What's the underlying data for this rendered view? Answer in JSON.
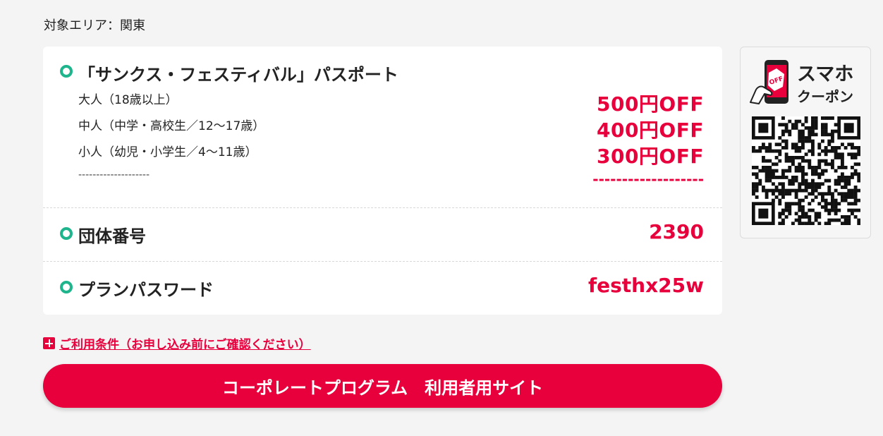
{
  "area": {
    "label": "対象エリア：関東"
  },
  "passport": {
    "title": "「サンクス・フェスティバル」パスポート",
    "tiers": [
      {
        "label": "大人（18歳以上）",
        "discount": "500円OFF"
      },
      {
        "label": "中人（中学・高校生／12～17歳）",
        "discount": "400円OFF"
      },
      {
        "label": "小人（幼児・小学生／4～11歳）",
        "discount": "300円OFF"
      }
    ],
    "separator_left": "--------------------",
    "separator_right": "-------------------"
  },
  "group": {
    "label": "団体番号",
    "value": "2390"
  },
  "plan": {
    "label": "プランパスワード",
    "value": "festhx25w"
  },
  "coupon": {
    "title": "スマホ",
    "subtitle": "クーポン",
    "phone_badge": "OFF",
    "icon": "smartphone-coupon-icon"
  },
  "terms": {
    "link_text": "ご利用条件（お申し込み前にご確認ください）",
    "icon": "plus-icon"
  },
  "cta": {
    "label": "コーポレートプログラム　利用者用サイト"
  },
  "colors": {
    "accent": "#e8003d",
    "bullet": "#1eb48c",
    "background": "#f4f4f4"
  }
}
